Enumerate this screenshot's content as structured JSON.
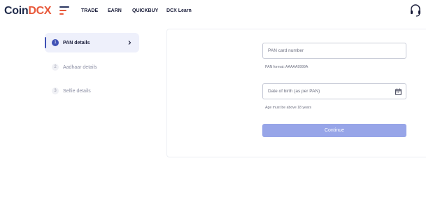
{
  "header": {
    "logo_part1": "Coin",
    "logo_part2": "DCX",
    "nav": [
      "TRADE",
      "EARN",
      "QUICKBUY",
      "DCX Learn"
    ]
  },
  "steps": [
    {
      "number": "1",
      "label": "PAN details",
      "active": true
    },
    {
      "number": "2",
      "label": "Aadhaar details",
      "active": false
    },
    {
      "number": "3",
      "label": "Selfie details",
      "active": false
    }
  ],
  "form": {
    "pan_placeholder": "PAN card number",
    "pan_hint": "PAN format: AAAAA9999A",
    "dob_placeholder": "Date of birth (as per PAN)",
    "dob_hint": "Age must be above 18 years",
    "continue_label": "Continue"
  },
  "colors": {
    "brand_dark": "#1f2a4a",
    "brand_orange": "#e8583a",
    "accent": "#3f51b5",
    "button_disabled": "#97a5e8"
  },
  "icons": {
    "menu": "menu-icon",
    "support": "headset-icon",
    "chevron": "chevron-right-icon",
    "calendar": "calendar-icon"
  }
}
